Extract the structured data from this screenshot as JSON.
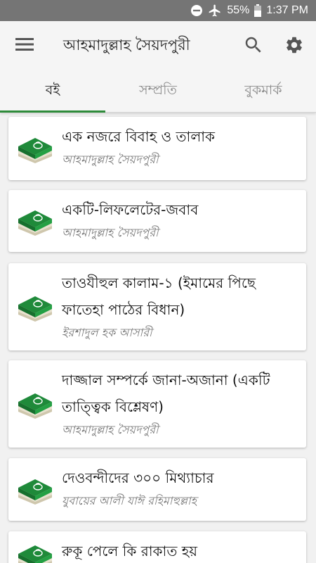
{
  "status_bar": {
    "battery": "55%",
    "time": "1:37 PM"
  },
  "app_bar": {
    "title": "আহমাদুল্লাহ সৈয়দপুরী",
    "icons": [
      "menu-icon",
      "search-icon",
      "settings-icon"
    ]
  },
  "tabs": [
    {
      "label": "বই",
      "active": true
    },
    {
      "label": "সম্প্রতি",
      "active": false
    },
    {
      "label": "বুকমার্ক",
      "active": false
    }
  ],
  "colors": {
    "accent": "#2e8b3a",
    "status_bar": "#757575",
    "book_green": "#1f8a3a"
  },
  "books": [
    {
      "title_lines": [
        "এক নজরে বিবাহ ও তালাক"
      ],
      "author": "আহমাদুল্লাহ সৈয়দপুরী"
    },
    {
      "title_lines": [
        "একটি-লিফলেটের-জবাব"
      ],
      "author": "আহমাদুল্লাহ সৈয়দপুরী"
    },
    {
      "title_lines": [
        "তাওযীহুল কালাম-১ (ইমামের পিছে",
        "ফাতেহা পাঠের বিধান)"
      ],
      "author": "ইরশাদুল হক আসারী"
    },
    {
      "title_lines": [
        "দাজ্জাল সম্পর্কে জানা-অজানা (একটি",
        "তাত্ত্বিক বিশ্লেষণ)"
      ],
      "author": "আহমাদুল্লাহ সৈয়দপুরী"
    },
    {
      "title_lines": [
        "দেওবন্দীদের ৩০০ মিথ্যাচার"
      ],
      "author": "যুবায়ের আলী যাঈ রহিমাহুল্লাহ"
    },
    {
      "title_lines": [
        "রুকূ পেলে কি রাকাত হয়"
      ],
      "author": ""
    }
  ]
}
